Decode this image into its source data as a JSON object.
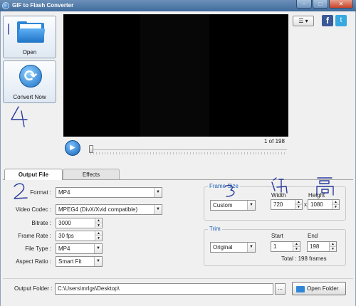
{
  "window": {
    "title": "GIF to Flash Converter",
    "minimize_glyph": "–",
    "maximize_glyph": "□",
    "close_glyph": "✕"
  },
  "sidebar": {
    "open_label": "Open",
    "convert_label": "Convert Now"
  },
  "topbar": {
    "menu_glyph": "☰ ▾",
    "facebook_glyph": "f",
    "twitter_glyph": "t"
  },
  "player": {
    "play_glyph": "▶",
    "frame_position": "1 of 198",
    "current_frame": 1,
    "total_frames": 198
  },
  "tabs": [
    {
      "label": "Output File",
      "active": true
    },
    {
      "label": "Effects",
      "active": false
    }
  ],
  "form": {
    "format_label": "Format :",
    "format_value": "MP4",
    "video_codec_label": "Video Codec :",
    "video_codec_value": "MPEG4 (DivX/Xvid compatible)",
    "bitrate_label": "Bitrate :",
    "bitrate_value": "3000",
    "frame_rate_label": "Frame Rate :",
    "frame_rate_value": "30 fps",
    "file_type_label": "File Type :",
    "file_type_value": "MP4",
    "aspect_ratio_label": "Aspect Ratio :",
    "aspect_ratio_value": "Smart Fit"
  },
  "frame_size": {
    "legend": "Frame Size",
    "preset_value": "Custom",
    "width_label": "Width",
    "width_value": "720",
    "times": "x",
    "height_label": "Height",
    "height_value": "1080"
  },
  "trim": {
    "legend": "Trim",
    "mode_value": "Original",
    "start_label": "Start",
    "start_value": "1",
    "end_label": "End",
    "end_value": "198",
    "total_text": "Total : 198 frames"
  },
  "output": {
    "folder_label": "Output Folder :",
    "folder_value": "C:\\Users\\mrlgs\\Desktop\\",
    "browse_label": "...",
    "open_folder_label": "Open Folder"
  },
  "colors": {
    "accent_blue": "#1a5fb4",
    "ink_annotation": "#2a3b9c",
    "preview_bg": "#000000"
  }
}
